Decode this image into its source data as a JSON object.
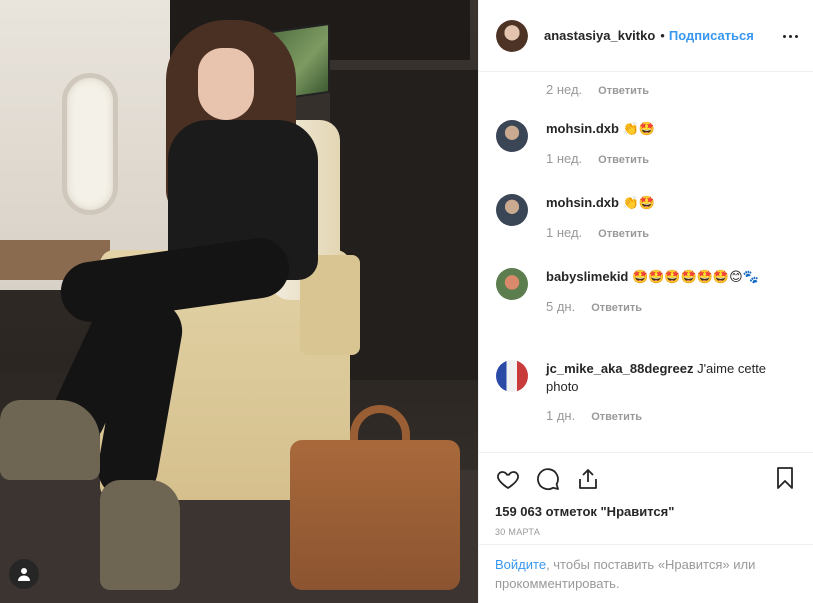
{
  "post": {
    "author": "anastasiya_kvitko",
    "separator": "•",
    "follow_label": "Подписаться"
  },
  "comments_top_meta": {
    "time": "2 нед.",
    "reply": "Ответить"
  },
  "comments": [
    {
      "user": "mohsin.dxb",
      "text": "👏🤩",
      "time": "1 нед.",
      "reply": "Ответить",
      "avatar_color": "#7a8fa3"
    },
    {
      "user": "mohsin.dxb",
      "text": "👏🤩",
      "time": "1 нед.",
      "reply": "Ответить",
      "avatar_color": "#7a8fa3"
    },
    {
      "user": "babyslimekid",
      "text": "🤩🤩🤩🤩🤩🤩😊🐾",
      "time": "5 дн.",
      "reply": "Ответить",
      "avatar_color": "#c7574c"
    },
    {
      "user": "jc_mike_aka_88degreez",
      "text": "J'aime cette photo",
      "time": "1 дн.",
      "reply": "Ответить",
      "avatar_color": "#3a56b5"
    }
  ],
  "likes": "159 063 отметок \"Нравится\"",
  "date": "30 МАРТА",
  "login": {
    "link": "Войдите",
    "rest": ", чтобы поставить «Нравится» или прокомментировать."
  }
}
